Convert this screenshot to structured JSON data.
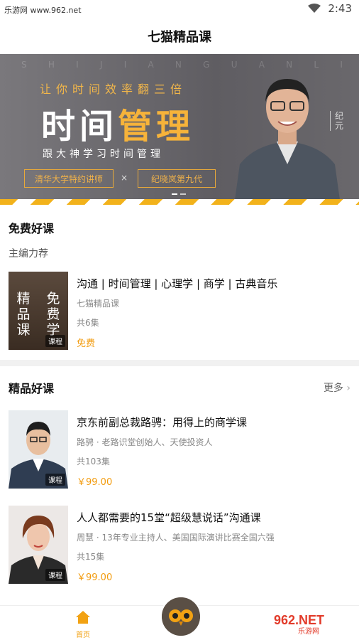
{
  "status": {
    "site": "乐游网 www.962.net",
    "time": "2:43"
  },
  "header": {
    "title": "七猫精品课"
  },
  "banner": {
    "letters": [
      "S",
      "H",
      "I",
      "J",
      "I",
      "A",
      "N",
      "G",
      "U",
      "A",
      "N",
      "L",
      "I"
    ],
    "subtitle": "让你时间效率翻三倍",
    "big_white": "时间",
    "big_yellow": "管理",
    "tagline": "跟大神学习时间管理",
    "pill1": "清华大学特约讲师",
    "times": "×",
    "pill2": "纪晓岚第九代",
    "side": "纪元"
  },
  "free": {
    "title": "免费好课",
    "subtitle": "主编力荐",
    "course": {
      "thumb_text": [
        "精",
        "免",
        "品",
        "费",
        "课",
        "学"
      ],
      "badge": "课程",
      "title": "沟通 | 时间管理 | 心理学 | 商学 | 古典音乐",
      "author": "七猫精品课",
      "episodes": "共6集",
      "price": "免费"
    }
  },
  "premium": {
    "title": "精品好课",
    "more": "更多",
    "courses": [
      {
        "badge": "课程",
        "title": "京东前副总裁路骋：用得上的商学课",
        "author": "路骋 · 老路识堂创始人、天使投资人",
        "episodes": "共103集",
        "price": "￥99.00"
      },
      {
        "badge": "课程",
        "title": "人人都需要的15堂“超级慧说话”沟通课",
        "author": "周慧 · 13年专业主持人、美国国际演讲比赛全国六强",
        "episodes": "共15集",
        "price": "￥99.00"
      }
    ]
  },
  "tabbar": {
    "home": "首页"
  },
  "watermark": {
    "big": "962.NET",
    "small": "乐游网"
  },
  "colors": {
    "accent": "#f29b0d",
    "banner_yellow": "#f6b33a"
  }
}
